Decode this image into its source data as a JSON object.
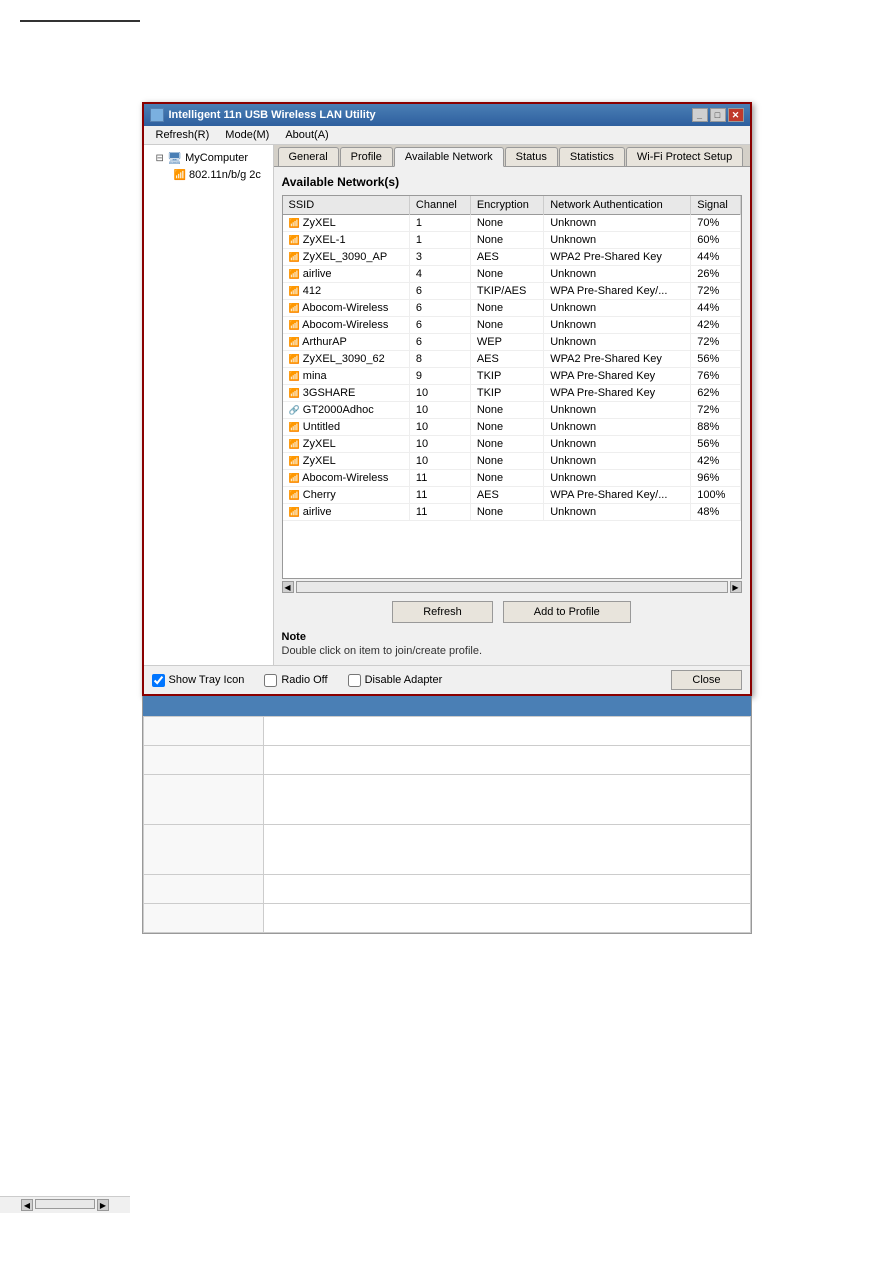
{
  "page": {
    "top_line": true
  },
  "window": {
    "title": "Intelligent 11n USB Wireless LAN Utility",
    "title_icon": "wifi-icon",
    "controls": {
      "minimize": "_",
      "restore": "□",
      "close": "✕"
    }
  },
  "menubar": {
    "items": [
      {
        "id": "refresh",
        "label": "Refresh(R)"
      },
      {
        "id": "mode",
        "label": "Mode(M)"
      },
      {
        "id": "about",
        "label": "About(A)"
      }
    ]
  },
  "sidebar": {
    "tree": [
      {
        "id": "mycomputer",
        "label": "MyComputer",
        "icon": "computer-icon",
        "children": [
          {
            "id": "adapter",
            "label": "802.11n/b/g 2c",
            "icon": "wifi-icon"
          }
        ]
      }
    ]
  },
  "tabs": [
    {
      "id": "general",
      "label": "General"
    },
    {
      "id": "profile",
      "label": "Profile"
    },
    {
      "id": "available-network",
      "label": "Available Network",
      "active": true
    },
    {
      "id": "status",
      "label": "Status"
    },
    {
      "id": "statistics",
      "label": "Statistics"
    },
    {
      "id": "wifi-protect-setup",
      "label": "Wi-Fi Protect Setup"
    }
  ],
  "available_network": {
    "panel_title": "Available Network(s)",
    "columns": [
      "SSID",
      "Channel",
      "Encryption",
      "Network Authentication",
      "Signal"
    ],
    "networks": [
      {
        "ssid": "ZyXEL",
        "channel": 1,
        "encryption": "None",
        "auth": "Unknown",
        "signal": "70%"
      },
      {
        "ssid": "ZyXEL-1",
        "channel": 1,
        "encryption": "None",
        "auth": "Unknown",
        "signal": "60%"
      },
      {
        "ssid": "ZyXEL_3090_AP",
        "channel": 3,
        "encryption": "AES",
        "auth": "WPA2 Pre-Shared Key",
        "signal": "44%"
      },
      {
        "ssid": "airlive",
        "channel": 4,
        "encryption": "None",
        "auth": "Unknown",
        "signal": "26%"
      },
      {
        "ssid": "412",
        "channel": 6,
        "encryption": "TKIP/AES",
        "auth": "WPA Pre-Shared Key/...",
        "signal": "72%"
      },
      {
        "ssid": "Abocom-Wireless",
        "channel": 6,
        "encryption": "None",
        "auth": "Unknown",
        "signal": "44%"
      },
      {
        "ssid": "Abocom-Wireless",
        "channel": 6,
        "encryption": "None",
        "auth": "Unknown",
        "signal": "42%"
      },
      {
        "ssid": "ArthurAP",
        "channel": 6,
        "encryption": "WEP",
        "auth": "Unknown",
        "signal": "72%"
      },
      {
        "ssid": "ZyXEL_3090_62",
        "channel": 8,
        "encryption": "AES",
        "auth": "WPA2 Pre-Shared Key",
        "signal": "56%"
      },
      {
        "ssid": "mina",
        "channel": 9,
        "encryption": "TKIP",
        "auth": "WPA Pre-Shared Key",
        "signal": "76%"
      },
      {
        "ssid": "3GSHARE",
        "channel": 10,
        "encryption": "TKIP",
        "auth": "WPA Pre-Shared Key",
        "signal": "62%"
      },
      {
        "ssid": "GT2000Adhoc",
        "channel": 10,
        "encryption": "None",
        "auth": "Unknown",
        "signal": "72%"
      },
      {
        "ssid": "Untitled",
        "channel": 10,
        "encryption": "None",
        "auth": "Unknown",
        "signal": "88%"
      },
      {
        "ssid": "ZyXEL",
        "channel": 10,
        "encryption": "None",
        "auth": "Unknown",
        "signal": "56%"
      },
      {
        "ssid": "ZyXEL",
        "channel": 10,
        "encryption": "None",
        "auth": "Unknown",
        "signal": "42%"
      },
      {
        "ssid": "Abocom-Wireless",
        "channel": 11,
        "encryption": "None",
        "auth": "Unknown",
        "signal": "96%"
      },
      {
        "ssid": "Cherry",
        "channel": 11,
        "encryption": "AES",
        "auth": "WPA Pre-Shared Key/...",
        "signal": "100%"
      },
      {
        "ssid": "airlive",
        "channel": 11,
        "encryption": "None",
        "auth": "Unknown",
        "signal": "48%"
      }
    ],
    "refresh_label": "Refresh",
    "add_to_profile_label": "Add to Profile",
    "note_label": "Note",
    "note_text": "Double click on item to join/create profile."
  },
  "bottom_bar": {
    "show_tray_icon_label": "Show Tray Icon",
    "show_tray_icon_checked": true,
    "radio_off_label": "Radio Off",
    "radio_off_checked": false,
    "disable_adapter_label": "Disable Adapter",
    "disable_adapter_checked": false,
    "close_label": "Close"
  },
  "bottom_table": {
    "header": "",
    "rows": [
      {
        "col1": "",
        "col2": ""
      },
      {
        "col1": "",
        "col2": ""
      },
      {
        "col1": "",
        "col2": ""
      },
      {
        "col1": "",
        "col2": ""
      },
      {
        "col1": "",
        "col2": ""
      },
      {
        "col1": "",
        "col2": ""
      }
    ]
  }
}
